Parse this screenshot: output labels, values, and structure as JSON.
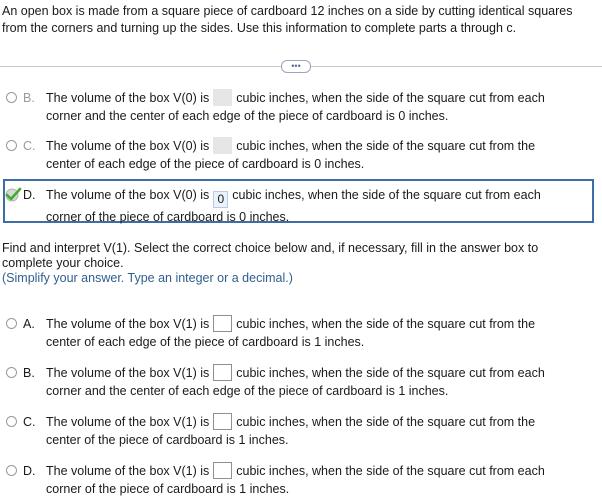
{
  "intro": {
    "line1": "An open box is made from a square piece of cardboard 12 inches on a side by cutting identical squares",
    "line2": "from the corners and turning up the sides. Use this information to complete parts a through c."
  },
  "expand_button": {
    "label": "•••"
  },
  "v0_choices": [
    {
      "letter": "B.",
      "pre": "The volume of the box V(0) is",
      "post": "cubic inches, when the side of the square cut from each",
      "line2": "corner and the center of each edge of the piece of cardboard is 0 inches."
    },
    {
      "letter": "C.",
      "pre": "The volume of the box V(0) is",
      "post": "cubic inches, when the side of the square cut from the",
      "line2": "center of each edge of the piece of cardboard is 0 inches."
    },
    {
      "letter": "D.",
      "pre": "The volume of the box V(0) is",
      "answer": "0",
      "post": "cubic inches, when the side of the square cut from each",
      "line2": "corner of the piece of cardboard is 0 inches."
    }
  ],
  "question": {
    "line1": "Find and interpret V(1). Select the correct choice below and, if necessary, fill in the answer box to",
    "line2": "complete your choice.",
    "hint": "(Simplify your answer. Type an integer or a decimal.)"
  },
  "v1_choices": [
    {
      "letter": "A.",
      "pre": "The volume of the box V(1) is",
      "post": "cubic inches, when the side of the square cut from the",
      "line2": "center of each edge of the piece of cardboard is 1 inches."
    },
    {
      "letter": "B.",
      "pre": "The volume of the box V(1) is",
      "post": "cubic inches, when the side of the square cut from each",
      "line2": "corner and the center of each edge of the piece of cardboard is 1 inches."
    },
    {
      "letter": "C.",
      "pre": "The volume of the box V(1) is",
      "post": "cubic inches, when the side of the square cut from the",
      "line2": "center of the piece of cardboard is 1 inches."
    },
    {
      "letter": "D.",
      "pre": "The volume of the box V(1) is",
      "post": "cubic inches, when the side of the square cut from each",
      "line2": "corner of the piece of cardboard is 1 inches."
    }
  ],
  "colors": {
    "selected_border": "#3a6ea5",
    "check": "#3fae2a",
    "hint": "#2f5f8f"
  }
}
